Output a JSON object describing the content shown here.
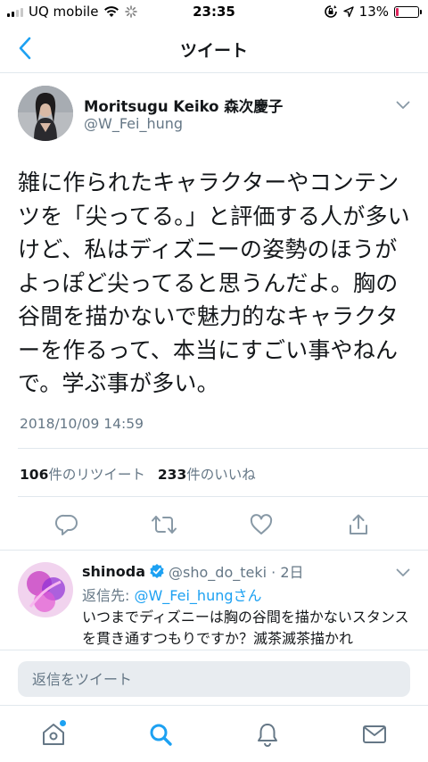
{
  "status_bar": {
    "carrier": "UQ mobile",
    "time": "23:35",
    "battery": "13%",
    "battery_level": 0.13
  },
  "nav": {
    "title": "ツイート"
  },
  "tweet": {
    "author_name": "Moritsugu Keiko 森次慶子",
    "author_handle": "@W_Fei_hung",
    "text": "雑に作られたキャラクターやコンテンツを「尖ってる。」と評価する人が多いけど、私はディズニーの姿勢のほうがよっぽど尖ってると思うんだよ。胸の谷間を描かないで魅力的なキャラクターを作るって、本当にすごい事やねんで。学ぶ事が多い。",
    "timestamp": "2018/10/09 14:59",
    "retweet_count": "106",
    "retweet_label": "件のリツイート",
    "like_count": "233",
    "like_label": "件のいいね"
  },
  "reply": {
    "name": "shinoda",
    "handle_time": "@sho_do_teki · 2日",
    "reply_prefix": "返信先: ",
    "reply_target": "@W_Fei_hungさん",
    "text": "いつまでディズニーは胸の谷間を描かないスタンスを貫き通すつもりですか？滅茶滅茶描かれ"
  },
  "compose": {
    "placeholder": "返信をツイート"
  },
  "icons": {
    "back": "chevron-left-icon",
    "caret": "chevron-down-icon",
    "reply": "reply-icon",
    "retweet": "retweet-icon",
    "like": "heart-icon",
    "share": "share-icon",
    "home": "home-icon",
    "search": "search-icon",
    "notifications": "bell-icon",
    "messages": "mail-icon",
    "verified": "verified-icon"
  },
  "colors": {
    "accent": "#1da1f2",
    "muted": "#657786",
    "icon": "#8899a6",
    "text": "#14171a",
    "battery_low": "#e0245e"
  }
}
